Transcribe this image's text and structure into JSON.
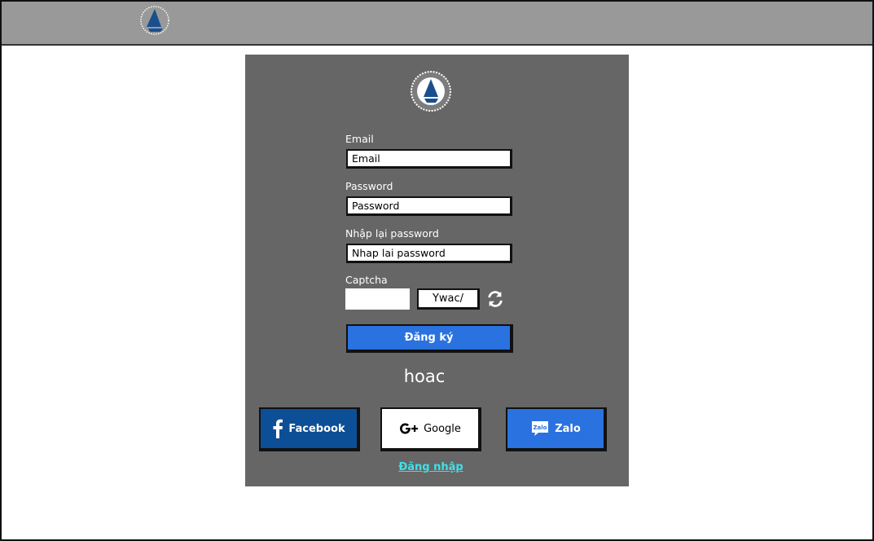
{
  "form": {
    "email_label": "Email",
    "email_placeholder": "Email",
    "password_label": "Password",
    "password_placeholder": "Password",
    "repassword_label": "Nhập lại password",
    "repassword_placeholder": "Nhap lai password",
    "captcha_label": "Captcha",
    "captcha_value": "Ywac/",
    "register_button": "Đăng ký",
    "or_text": "hoac",
    "login_link": "Đăng nhập"
  },
  "social": {
    "facebook": "Facebook",
    "google": "Google",
    "zalo": "Zalo",
    "zalo_badge": "Zalo"
  },
  "colors": {
    "topbar": "#999999",
    "panel": "#666666",
    "primary_button": "#2a72e0",
    "facebook": "#0c4f97",
    "link": "#3fe0e8"
  },
  "icons": [
    "university-logo",
    "refresh-icon",
    "facebook-icon",
    "google-plus-icon",
    "zalo-icon"
  ]
}
